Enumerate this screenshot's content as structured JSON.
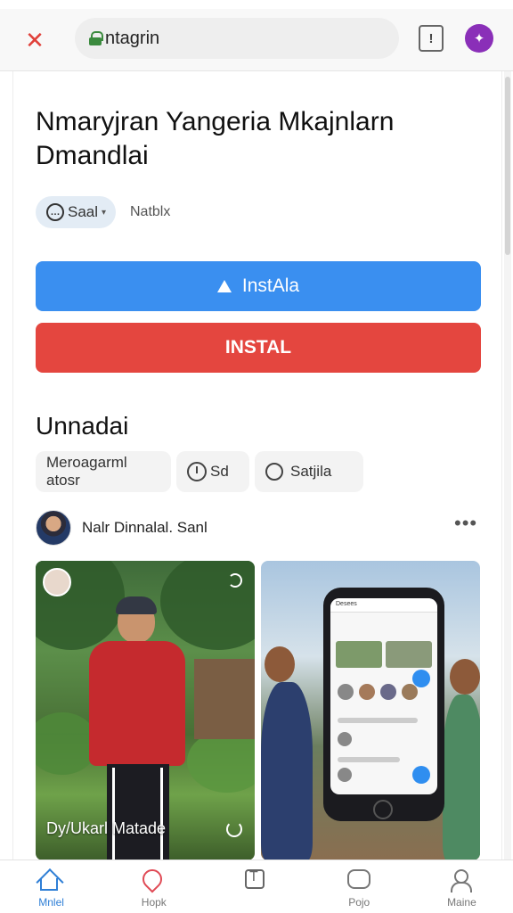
{
  "browser": {
    "url_text": "ntagrin",
    "accent": "#8a2fb8"
  },
  "app": {
    "title": "Nmaryjran Yangeria Mkajnlarn Dmandlai",
    "chip_label": "Saal",
    "meta": "Natblx",
    "install_primary": "InstAla",
    "install_secondary": "INSTAL",
    "colors": {
      "primary": "#3a8ff0",
      "danger": "#e4463f"
    }
  },
  "section": {
    "title": "Unnadai",
    "filters": [
      "Meroagarml atosr",
      "Sd",
      "Satjila"
    ]
  },
  "author": {
    "name": "Nalr Dinnalal. Sanl"
  },
  "photos": {
    "left_caption": "Dy/Ukarl Matade",
    "right_screen_title": "Desees"
  },
  "nav": {
    "items": [
      {
        "label": "Mnlel",
        "icon": "home-icon",
        "active": true
      },
      {
        "label": "Hopk",
        "icon": "heart-icon",
        "active": false
      },
      {
        "label": "",
        "icon": "text-box-icon",
        "active": false
      },
      {
        "label": "Pojo",
        "icon": "gamepad-icon",
        "active": false
      },
      {
        "label": "Maine",
        "icon": "profile-icon",
        "active": false
      }
    ]
  }
}
